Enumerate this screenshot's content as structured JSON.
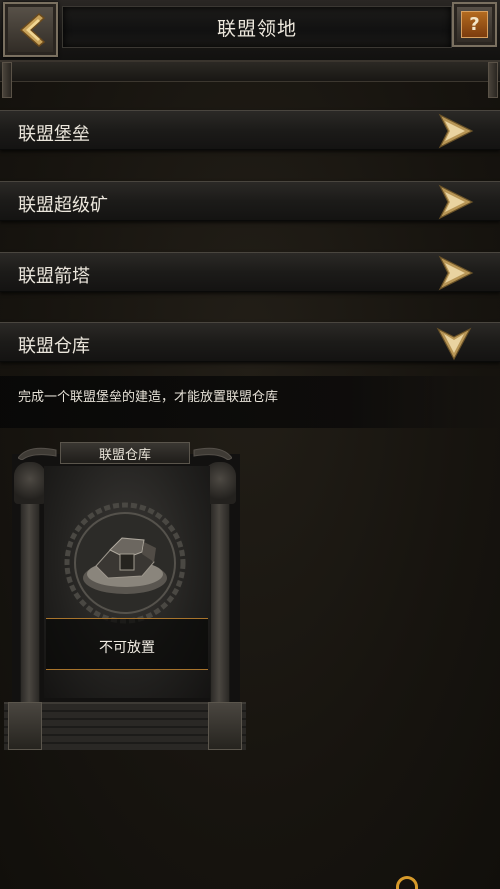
{
  "header": {
    "title": "联盟领地",
    "back_icon": "back-arrow-icon",
    "help_label": "?"
  },
  "sections": [
    {
      "label": "联盟堡垒",
      "state": "collapsed",
      "icon": "chevron-right-icon"
    },
    {
      "label": "联盟超级矿",
      "state": "collapsed",
      "icon": "chevron-right-icon"
    },
    {
      "label": "联盟箭塔",
      "state": "collapsed",
      "icon": "chevron-right-icon"
    },
    {
      "label": "联盟仓库",
      "state": "expanded",
      "icon": "chevron-down-icon"
    }
  ],
  "expanded": {
    "description": "完成一个联盟堡垒的建造，才能放置联盟仓库",
    "card": {
      "title": "联盟仓库",
      "status": "不可放置",
      "image_icon": "warehouse-icon"
    }
  },
  "colors": {
    "accent_gold": "#c9a35a",
    "background": "#17140f",
    "help_orange": "#b36b1f"
  }
}
